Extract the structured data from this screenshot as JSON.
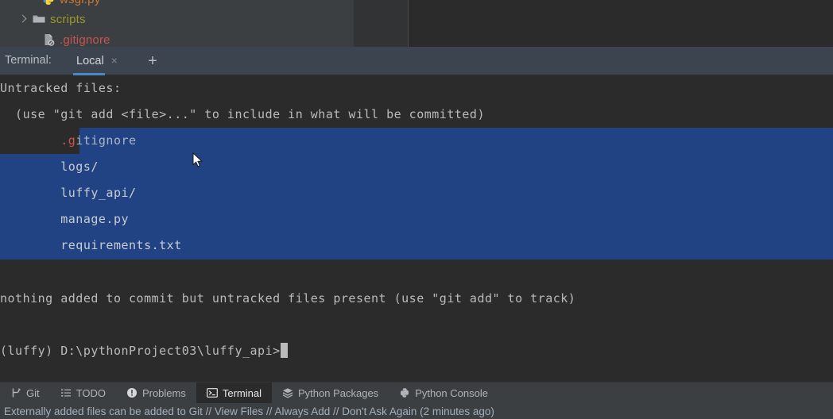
{
  "project_tree": {
    "rows": [
      {
        "name": "wsgi.py",
        "icon": "python-file-icon",
        "color": "#cc7832",
        "indent": 52,
        "chevron": false
      },
      {
        "name": "scripts",
        "icon": "folder-icon",
        "color": "#9a9a28",
        "indent": 22,
        "chevron": true
      },
      {
        "name": ".gitignore",
        "icon": "gitignore-file-icon",
        "color": "#c75450",
        "indent": 52,
        "chevron": false
      }
    ]
  },
  "terminal_panel": {
    "title": "Terminal:",
    "tab": {
      "label": "Local",
      "close_icon": "close-icon"
    },
    "add_tab_icon": "plus-icon",
    "add_tab_label": "+",
    "close_glyph": "×"
  },
  "terminal": {
    "lines": [
      {
        "text": "Untracked files:",
        "selected": false
      },
      {
        "text": "",
        "selected": false
      },
      {
        "text": "  (use \"git add <file>...\" to include in what will be committed)",
        "selected": false
      },
      {
        "text": "        .gitignore",
        "selected": "partial",
        "prefix": "        .g",
        "rest": "itignore"
      },
      {
        "text": "        logs/",
        "selected": true
      },
      {
        "text": "        luffy_api/",
        "selected": true
      },
      {
        "text": "        manage.py",
        "selected": true
      },
      {
        "text": "        requirements.txt",
        "selected": true
      },
      {
        "text": "",
        "selected": false
      },
      {
        "text": "nothing added to commit but untracked files present (use \"git add\" to track)",
        "selected": false
      },
      {
        "text": "",
        "selected": false
      },
      {
        "text": "",
        "selected": false
      }
    ],
    "prompt": "(luffy) D:\\pythonProject03\\luffy_api>",
    "cursor": "block-cursor",
    "selection_color": "#214283",
    "background_color": "#2b2b2b",
    "text_color": "#bbbbbb"
  },
  "toolbar": {
    "items": [
      {
        "label": "Git",
        "icon": "git-branch-icon",
        "active": false
      },
      {
        "label": "TODO",
        "icon": "todo-list-icon",
        "active": false
      },
      {
        "label": "Problems",
        "icon": "problems-icon",
        "active": false
      },
      {
        "label": "Terminal",
        "icon": "terminal-icon",
        "active": true
      },
      {
        "label": "Python Packages",
        "icon": "packages-icon",
        "active": false
      },
      {
        "label": "Python Console",
        "icon": "python-icon",
        "active": false
      }
    ]
  },
  "status_bar": {
    "message": "Externally added files can be added to Git // View Files // Always Add // Don't Ask Again (2 minutes ago)"
  }
}
